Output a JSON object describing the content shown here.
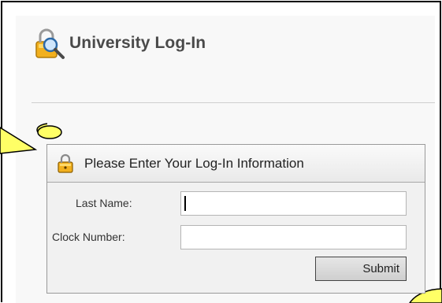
{
  "page": {
    "title": "University Log-In",
    "title_icon": "padlock-magnifier-icon"
  },
  "login": {
    "header": "Please Enter Your Log-In Information",
    "header_icon": "padlock-icon",
    "fields": {
      "last_name": {
        "label": "Last Name:",
        "value": ""
      },
      "clock_number": {
        "label": "Clock Number:",
        "value": ""
      }
    },
    "submit_label": "Submit"
  },
  "colors": {
    "callout_fill": "#ffff66",
    "title_text": "#4a4a4a",
    "box_background": "#f1f1f1",
    "box_border": "#9a9a9a"
  }
}
